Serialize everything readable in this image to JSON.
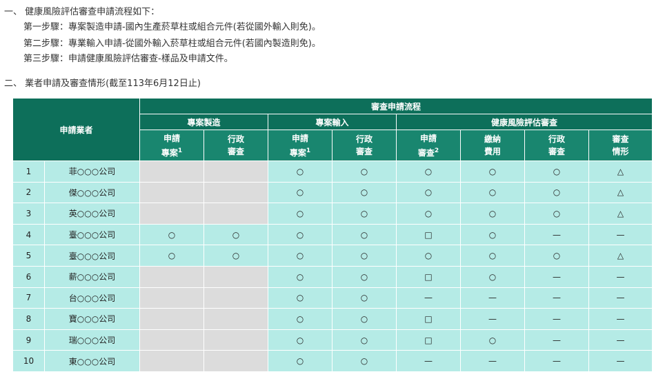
{
  "intro": {
    "heading1": "一、 健康風險評估審查申請流程如下：",
    "step1": "第一步驟：專案製造申請-國內生產菸草柱或組合元件(若從國外輸入則免)。",
    "step2": "第二步驟：專業輸入申請-從國外輸入菸草柱或組合元件(若國內製造則免)。",
    "step3": "第三步驟：申請健康風險評估審查-樣品及申請文件。",
    "heading2": "二、 業者申請及審查情形(截至113年6月12日止)"
  },
  "table": {
    "applicant_header": "申請業者",
    "process_header": "審查申請流程",
    "groups": {
      "manufacture": "專案製造",
      "import": "專案輸入",
      "hra": "健康風險評估審查"
    },
    "columns": {
      "c1a": "申請",
      "c1b": "專案",
      "c1sup": "1",
      "c2a": "行政",
      "c2b": "審查",
      "c3a": "申請",
      "c3b": "專案",
      "c3sup": "1",
      "c4a": "行政",
      "c4b": "審查",
      "c5a": "申請",
      "c5b": "審查",
      "c5sup": "2",
      "c6a": "繳納",
      "c6b": "費用",
      "c7a": "行政",
      "c7b": "審查",
      "c8a": "審查",
      "c8b": "情形"
    },
    "rows": [
      {
        "no": "1",
        "company": "菲○○○公司",
        "c": [
          "",
          "",
          "○",
          "○",
          "○",
          "○",
          "○",
          "△"
        ]
      },
      {
        "no": "2",
        "company": "傑○○○公司",
        "c": [
          "",
          "",
          "○",
          "○",
          "○",
          "○",
          "○",
          "△"
        ]
      },
      {
        "no": "3",
        "company": "英○○○公司",
        "c": [
          "",
          "",
          "○",
          "○",
          "○",
          "○",
          "○",
          "△"
        ]
      },
      {
        "no": "4",
        "company": "臺○○○公司",
        "c": [
          "○",
          "○",
          "○",
          "○",
          "□",
          "○",
          "—",
          "—"
        ]
      },
      {
        "no": "5",
        "company": "臺○○○公司",
        "c": [
          "○",
          "○",
          "○",
          "○",
          "○",
          "○",
          "○",
          "△"
        ]
      },
      {
        "no": "6",
        "company": "薪○○○公司",
        "c": [
          "",
          "",
          "○",
          "○",
          "□",
          "○",
          "—",
          "—"
        ]
      },
      {
        "no": "7",
        "company": "台○○○公司",
        "c": [
          "",
          "",
          "○",
          "○",
          "—",
          "—",
          "—",
          "—"
        ]
      },
      {
        "no": "8",
        "company": "寶○○○公司",
        "c": [
          "",
          "",
          "○",
          "○",
          "□",
          "—",
          "—",
          "—"
        ]
      },
      {
        "no": "9",
        "company": "瑞○○○公司",
        "c": [
          "",
          "",
          "○",
          "○",
          "□",
          "○",
          "—",
          "—"
        ]
      },
      {
        "no": "10",
        "company": "東○○○公司",
        "c": [
          "",
          "",
          "○",
          "○",
          "—",
          "—",
          "—",
          "—"
        ]
      }
    ],
    "gray_flags": [
      [
        true,
        true
      ],
      [
        true,
        true
      ],
      [
        true,
        true
      ],
      [
        false,
        false
      ],
      [
        false,
        false
      ],
      [
        true,
        true
      ],
      [
        true,
        true
      ],
      [
        true,
        true
      ],
      [
        true,
        true
      ],
      [
        true,
        true
      ]
    ]
  }
}
